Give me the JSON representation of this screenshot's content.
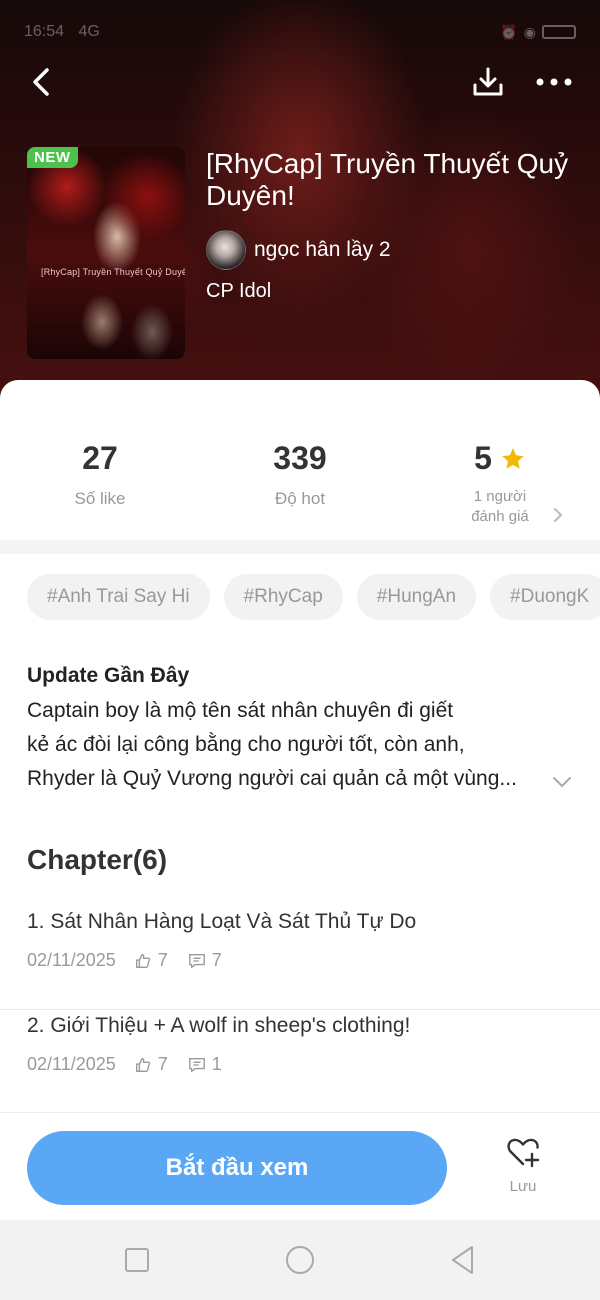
{
  "status_bar": {
    "time": "16:54",
    "signal": "4G",
    "battery": ""
  },
  "hero": {
    "badge": "NEW",
    "cover_caption": "[RhyCap] Truyền Thuyết Quỷ Duyên",
    "title": "[RhyCap] Truyền Thuyết Quỷ Duyên!",
    "author": "ngọc hân lầy 2",
    "category": "CP Idol"
  },
  "stats": {
    "likes": {
      "value": "27",
      "label": "Số like"
    },
    "hot": {
      "value": "339",
      "label": "Độ hot"
    },
    "rating": {
      "value": "5",
      "label_line1": "1 người",
      "label_line2": "đánh giá"
    }
  },
  "tags": [
    "#Anh Trai Say Hi",
    "#RhyCap",
    "#HungAn",
    "#DuongK"
  ],
  "update": {
    "title": "Update Gần Đây",
    "line1": "Captain boy là mộ tên sát nhân chuyên đi giết",
    "line2": "kẻ ác đòi lại công bằng cho người tốt, còn anh,",
    "line3": "Rhyder là Quỷ Vương người cai quản cả một vùng..."
  },
  "chapters": {
    "heading": "Chapter(6)",
    "items": [
      {
        "title": "1. Sát Nhân Hàng Loạt Và Sát Thủ Tự Do",
        "date": "02/11/2025",
        "likes": "7",
        "comments": "7"
      },
      {
        "title": "2. Giới Thiệu + A wolf in sheep's clothing!",
        "date": "02/11/2025",
        "likes": "7",
        "comments": "1"
      }
    ]
  },
  "actions": {
    "start_label": "Bắt đầu xem",
    "save_label": "Lưu"
  },
  "colors": {
    "accent": "#5aa8f5",
    "badge": "#4cc24c",
    "star": "#f5b800"
  },
  "icons": [
    "back-arrow-icon",
    "download-icon",
    "more-dots-icon",
    "star-icon",
    "chevron-right-icon",
    "chevron-down-icon",
    "thumbs-up-icon",
    "comment-icon",
    "heart-plus-icon",
    "square-icon",
    "circle-icon",
    "triangle-back-icon"
  ]
}
